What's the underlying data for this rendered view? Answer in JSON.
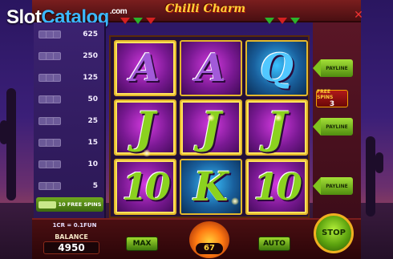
{
  "logo": {
    "part_a": "Slot",
    "part_b": "Catalog",
    "part_c": ".com"
  },
  "game": {
    "title": "Chilli Charm"
  },
  "paytable": {
    "values": [
      "625",
      "250",
      "125",
      "50",
      "25",
      "15",
      "10",
      "5"
    ],
    "free_spins_label": "10 FREE SPINS"
  },
  "reels": [
    [
      "A",
      "J",
      "10"
    ],
    [
      "A",
      "J",
      "K"
    ],
    [
      "Q",
      "J",
      "10"
    ]
  ],
  "right_panel": {
    "payline_label": "PAYLINE",
    "free_spins_title": "FREE SPINS",
    "free_spins_count": "3"
  },
  "bottom": {
    "credit_rate": "1CR = 0.1FUN",
    "balance_label": "BALANCE",
    "balance_value": "4950",
    "max_label": "MAX",
    "bet_value": "67",
    "auto_label": "AUTO",
    "stop_label": "STOP"
  },
  "colors": {
    "accent_green": "#8bd21f",
    "frame_red": "#7a1e1e",
    "title_gold": "#ffd23a"
  }
}
